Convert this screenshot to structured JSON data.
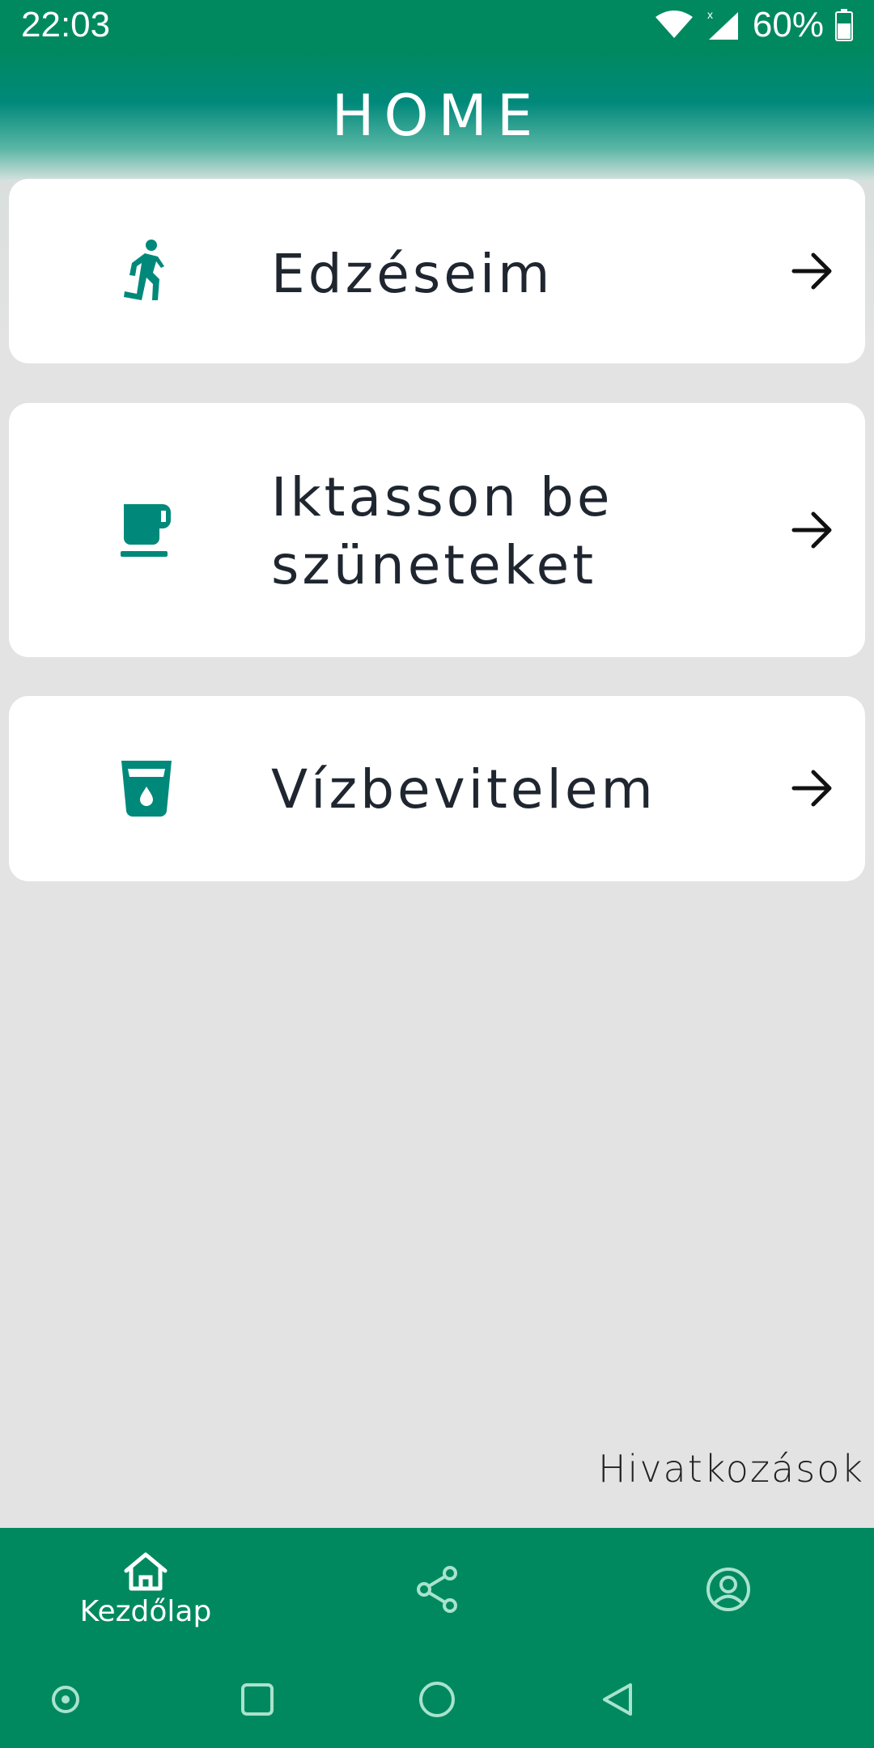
{
  "status_bar": {
    "time": "22:03",
    "battery": "60%",
    "icons": [
      "wifi-icon",
      "signal-icon",
      "battery-icon"
    ]
  },
  "header": {
    "title": "HOME"
  },
  "cards": [
    {
      "label": "Edzéseim",
      "icon": "running-icon"
    },
    {
      "label": "Iktasson be szüneteket",
      "icon": "coffee-cup-icon"
    },
    {
      "label": "Vízbevitelem",
      "icon": "water-glass-icon"
    }
  ],
  "footer_link": "Hivatkozások",
  "bottom_nav": {
    "items": [
      {
        "label": "Kezdőlap",
        "icon": "home-icon",
        "active": true
      },
      {
        "label": "",
        "icon": "share-icon",
        "active": false
      },
      {
        "label": "",
        "icon": "account-icon",
        "active": false
      }
    ]
  },
  "system_nav": [
    "record-icon",
    "recents-icon",
    "home-circle-icon",
    "back-icon"
  ],
  "colors": {
    "primary": "#00895f",
    "accent_icon": "#00897a",
    "background": "#e3e3e3",
    "card": "#ffffff",
    "text": "#1f2630"
  }
}
